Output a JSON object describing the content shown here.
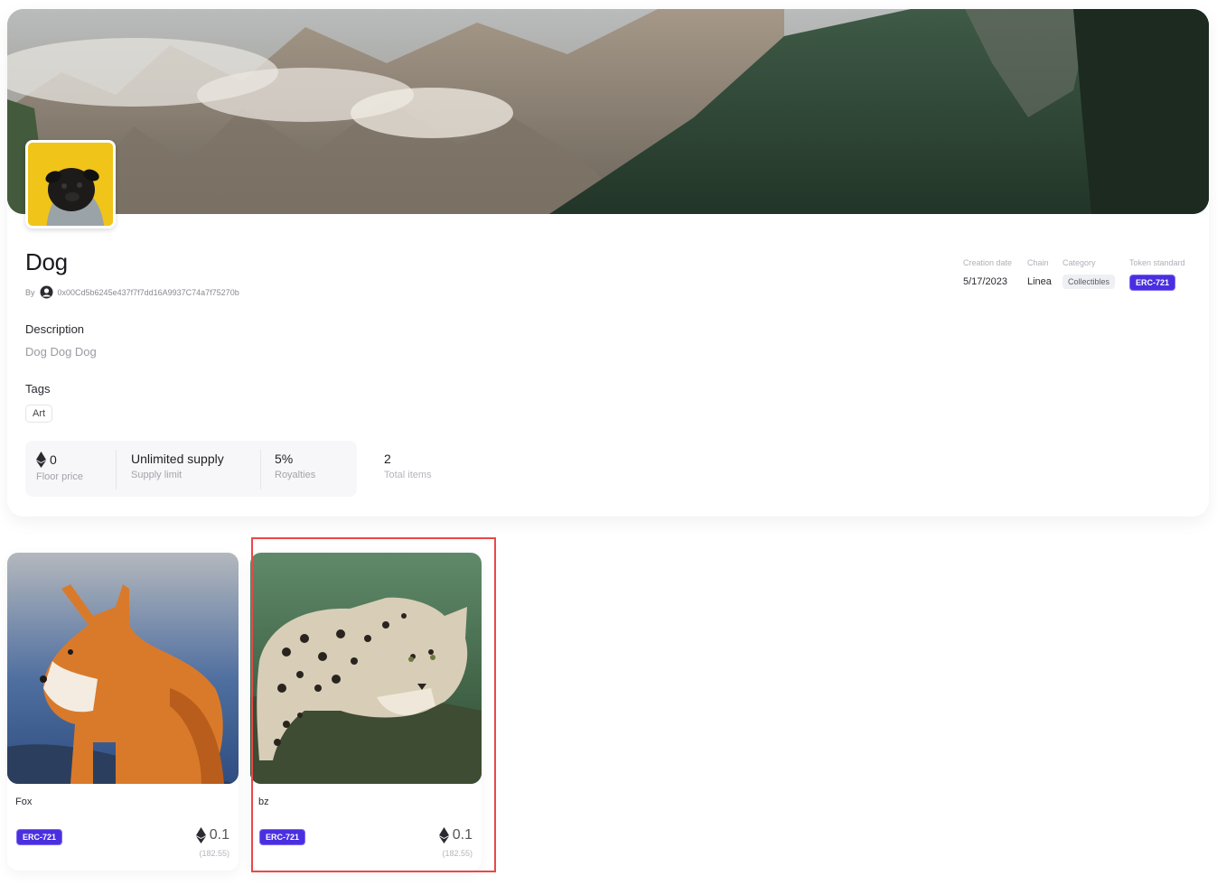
{
  "collection": {
    "title": "Dog",
    "by_label": "By",
    "creator_address": "0x00Cd5b6245e437f7f7dd16A9937C74a7f75270b",
    "description_label": "Description",
    "description": "Dog Dog Dog",
    "tags_label": "Tags",
    "tags": [
      "Art"
    ],
    "meta": {
      "creation_date_label": "Creation date",
      "creation_date": "5/17/2023",
      "chain_label": "Chain",
      "chain": "Linea",
      "category_label": "Category",
      "category": "Collectibles",
      "token_standard_label": "Token standard",
      "token_standard": "ERC-721"
    },
    "stats": {
      "floor_price": "0",
      "floor_price_label": "Floor price",
      "supply": "Unlimited supply",
      "supply_label": "Supply limit",
      "royalties": "5%",
      "royalties_label": "Royalties",
      "total_items": "2",
      "total_items_label": "Total items"
    }
  },
  "items": [
    {
      "name": "Fox",
      "standard": "ERC-721",
      "price": "0.1",
      "usd": "(182.55)"
    },
    {
      "name": "bz",
      "standard": "ERC-721",
      "price": "0.1",
      "usd": "(182.55)"
    }
  ],
  "colors": {
    "accent": "#4a2fe0",
    "selection": "#e94848"
  },
  "icons": {
    "currency": "ethereum-icon",
    "creator": "user-icon"
  }
}
